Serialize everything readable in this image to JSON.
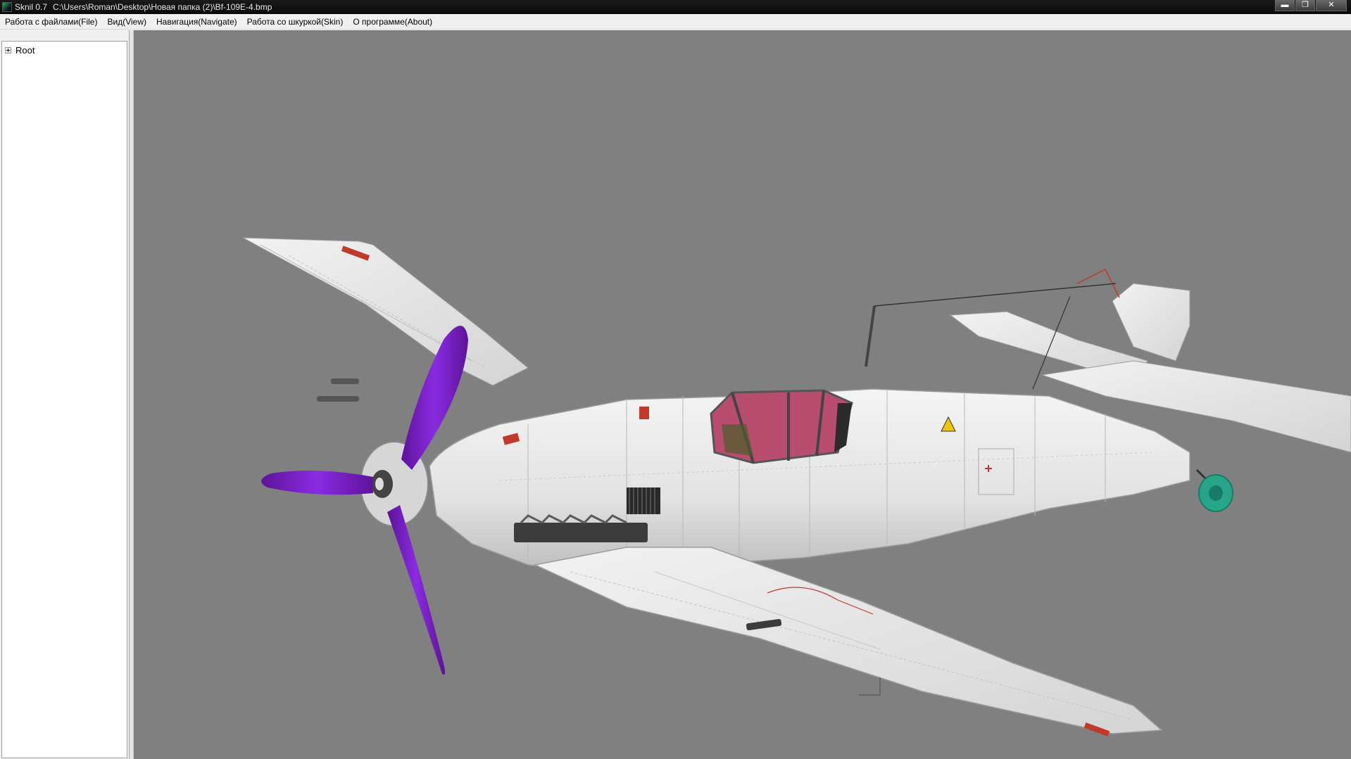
{
  "window": {
    "app_name": "Sknil 0.7",
    "file_path": "C:\\Users\\Roman\\Desktop\\Новая папка (2)\\Bf-109E-4.bmp",
    "controls": {
      "minimize": "▬",
      "maximize": "❐",
      "close": "✕"
    }
  },
  "menubar": {
    "items": [
      {
        "label": "Работа с файлами(File)"
      },
      {
        "label": "Вид(View)"
      },
      {
        "label": "Навигация(Navigate)"
      },
      {
        "label": "Работа со шкуркой(Skin)"
      },
      {
        "label": "О программе(About)"
      }
    ]
  },
  "tree": {
    "root_label": "Root"
  },
  "viewport": {
    "background": "#808080",
    "model": {
      "fuselage_color": "#e8e8e8",
      "propeller_color": "#7a1fc4",
      "canopy_tint": "#c05a78",
      "tailwheel_color": "#26a589",
      "warning_decal": "87"
    }
  }
}
